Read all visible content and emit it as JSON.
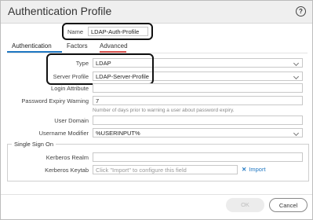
{
  "dialog": {
    "title": "Authentication Profile",
    "help_icon": "help-icon",
    "help_glyph": "?"
  },
  "name": {
    "label": "Name",
    "value": "LDAP-Auth-Profile"
  },
  "tabs": [
    {
      "label": "Authentication",
      "active": true
    },
    {
      "label": "Factors",
      "active": false
    },
    {
      "label": "Advanced",
      "active": false
    }
  ],
  "fields": {
    "type": {
      "label": "Type",
      "value": "LDAP"
    },
    "server_profile": {
      "label": "Server Profile",
      "value": "LDAP-Server-Profile"
    },
    "login_attribute": {
      "label": "Login Attribute",
      "value": ""
    },
    "password_expiry": {
      "label": "Password Expiry Warning",
      "value": "7",
      "hint": "Number of days prior to warning a user about password expiry."
    },
    "user_domain": {
      "label": "User Domain",
      "value": ""
    },
    "username_modifier": {
      "label": "Username Modifier",
      "value": "%USERINPUT%"
    }
  },
  "sso": {
    "title": "Single Sign On",
    "kerberos_realm": {
      "label": "Kerberos Realm",
      "value": ""
    },
    "kerberos_keytab": {
      "label": "Kerberos Keytab",
      "placeholder": "Click \"Import\" to configure this field",
      "import_label": "Import",
      "import_icon": "x-icon"
    }
  },
  "buttons": {
    "ok": "OK",
    "cancel": "Cancel"
  },
  "colors": {
    "tab_active": "#1f77c2",
    "tab_advanced_underline": "#d9534f",
    "link": "#1f77c2"
  }
}
